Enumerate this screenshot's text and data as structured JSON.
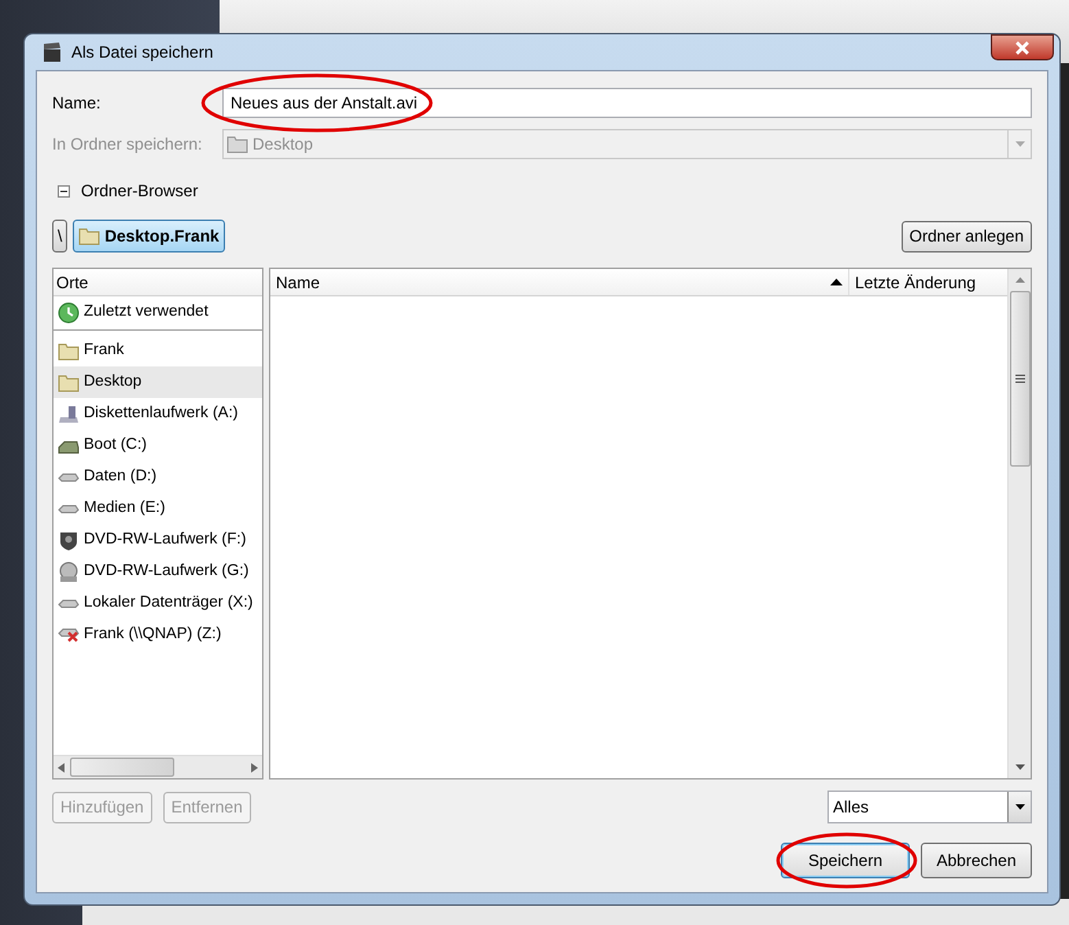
{
  "window": {
    "title": "Als Datei speichern"
  },
  "name_field": {
    "label": "Name:",
    "value": "Neues aus der Anstalt.avi",
    "circled": true
  },
  "folder_field": {
    "label": "In Ordner speichern:",
    "value": "Desktop",
    "disabled": true
  },
  "browser_toggle": {
    "label": "Ordner-Browser",
    "expanded": true
  },
  "path": [
    {
      "label": "\\",
      "selected": false
    },
    {
      "label": "Desktop.Frank",
      "selected": true
    }
  ],
  "create_folder_button": "Ordner anlegen",
  "places": {
    "heading": "Orte",
    "items": [
      {
        "label": "Zuletzt verwendet",
        "kind": "recent",
        "selected": false
      },
      {
        "label": "Frank",
        "kind": "folder",
        "selected": false
      },
      {
        "label": "Desktop",
        "kind": "folder",
        "selected": true
      },
      {
        "label": "Diskettenlaufwerk (A:)",
        "kind": "floppy",
        "selected": false
      },
      {
        "label": "Boot (C:)",
        "kind": "system",
        "selected": false
      },
      {
        "label": "Daten (D:)",
        "kind": "drive",
        "selected": false
      },
      {
        "label": "Medien (E:)",
        "kind": "drive",
        "selected": false
      },
      {
        "label": "DVD-RW-Laufwerk (F:)",
        "kind": "dvd",
        "selected": false
      },
      {
        "label": "DVD-RW-Laufwerk (G:)",
        "kind": "disc",
        "selected": false
      },
      {
        "label": "Lokaler Datenträger (X:)",
        "kind": "drive",
        "selected": false
      },
      {
        "label": "Frank (\\\\QNAP) (Z:)",
        "kind": "network",
        "selected": false
      }
    ]
  },
  "files": {
    "columns": [
      {
        "label": "Name",
        "sorted": true
      },
      {
        "label": "Letzte Änderung",
        "sorted": false
      }
    ]
  },
  "place_buttons": [
    {
      "label": "Hinzufügen",
      "disabled": true
    },
    {
      "label": "Entfernen",
      "disabled": true
    }
  ],
  "filter": {
    "value": "Alles"
  },
  "buttons": [
    {
      "label": "Speichern",
      "default": true,
      "circled": true
    },
    {
      "label": "Abbrechen",
      "default": false,
      "circled": false
    }
  ]
}
